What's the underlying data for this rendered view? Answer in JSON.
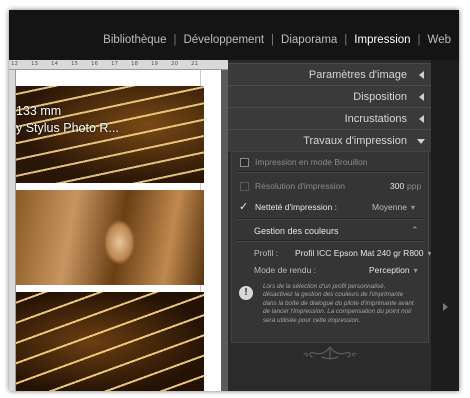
{
  "modules": {
    "items": [
      {
        "label": "Bibliothèque"
      },
      {
        "label": "Développement"
      },
      {
        "label": "Diaporama"
      },
      {
        "label": "Impression"
      },
      {
        "label": "Web"
      }
    ],
    "active": "Impression"
  },
  "preview": {
    "ruler_ticks": [
      "12",
      "13",
      "14",
      "15",
      "16",
      "17",
      "18",
      "19",
      "20",
      "21"
    ],
    "overlay_line1": "133 mm",
    "overlay_line2": "y Stylus Photo R..."
  },
  "panel": {
    "sections": {
      "image_settings": "Paramètres d'image",
      "layout": "Disposition",
      "overlays": "Incrustations",
      "print_job": "Travaux d'impression"
    },
    "draft_mode": {
      "label": "Impression en mode Brouillon",
      "checked": false
    },
    "resolution": {
      "label": "Résolution d'impression",
      "value": "300",
      "unit": "ppp"
    },
    "sharpening": {
      "label": "Netteté d'impression :",
      "value": "Moyenne",
      "checked": true
    },
    "color_management": {
      "title": "Gestion des couleurs",
      "collapse_icon": "double-chevron-up-icon"
    },
    "profile": {
      "label": "Profil :",
      "value": "Profil ICC Epson Mat 240 gr R800"
    },
    "intent": {
      "label": "Mode de rendu :",
      "value": "Perception"
    },
    "note": "Lors de la sélection d'un profil personnalisé, désactivez la gestion des couleurs de l'imprimante dans la boîte de dialogue du pilote d'imprimante avant de lancer l'impression. La compensation du point noir sera utilisée pour cette impression."
  },
  "colors": {
    "panel_bg": "#2b2b2b",
    "header_bg": "#3a3a3a",
    "active_module": "#ffffff"
  }
}
